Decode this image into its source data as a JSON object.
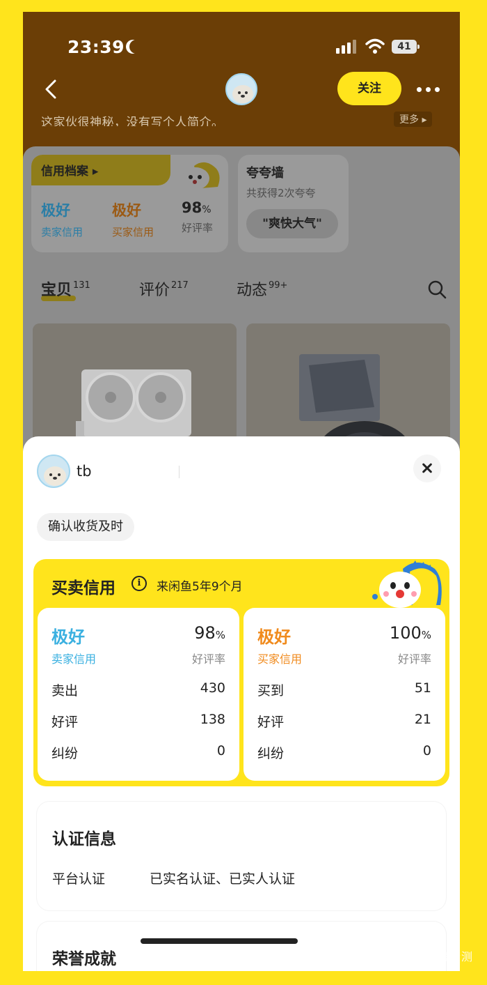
{
  "status_bar": {
    "time": "23:39",
    "battery": "41"
  },
  "header": {
    "follow_label": "关注",
    "bio": "这家伙很神秘，没有写个人简介。",
    "more_label": "更多 ▸"
  },
  "profile": {
    "credit_tab_label": "信用档案 ▸",
    "seller_rating": "极好",
    "seller_rating_label": "卖家信用",
    "buyer_rating": "极好",
    "buyer_rating_label": "买家信用",
    "positive_rate": "98",
    "positive_rate_unit": "%",
    "positive_rate_label": "好评率",
    "praise_wall_title": "夸夸墙",
    "praise_count": "共获得2次夸夸",
    "praise_tag": "\"爽快大气\""
  },
  "tabs": [
    {
      "label": "宝贝",
      "count": "131"
    },
    {
      "label": "评价",
      "count": "217"
    },
    {
      "label": "动态",
      "count": "99+"
    }
  ],
  "sheet": {
    "username": "tb",
    "tag": "确认收货及时",
    "credit_title": "买卖信用",
    "member_since": "来闲鱼5年9个月",
    "seller": {
      "rating": "极好",
      "label": "卖家信用",
      "rate": "98",
      "rate_unit": "%",
      "rate_label": "好评率",
      "rows": [
        {
          "label": "卖出",
          "value": "430"
        },
        {
          "label": "好评",
          "value": "138"
        },
        {
          "label": "纠纷",
          "value": "0"
        }
      ]
    },
    "buyer": {
      "rating": "极好",
      "label": "买家信用",
      "rate": "100",
      "rate_unit": "%",
      "rate_label": "好评率",
      "rows": [
        {
          "label": "买到",
          "value": "51"
        },
        {
          "label": "好评",
          "value": "21"
        },
        {
          "label": "纠纷",
          "value": "0"
        }
      ]
    },
    "verification_title": "认证信息",
    "verification_label": "平台认证",
    "verification_value": "已实名认证、已实人认证",
    "honor_title": "荣誉成就"
  },
  "watermark": "新浪众测",
  "colors": {
    "page_border": "#ffe41c",
    "header_brown": "#6b3e06",
    "seller_blue": "#3ab0e0",
    "buyer_orange": "#f08a1c",
    "accent_yellow": "#ffe41c"
  }
}
